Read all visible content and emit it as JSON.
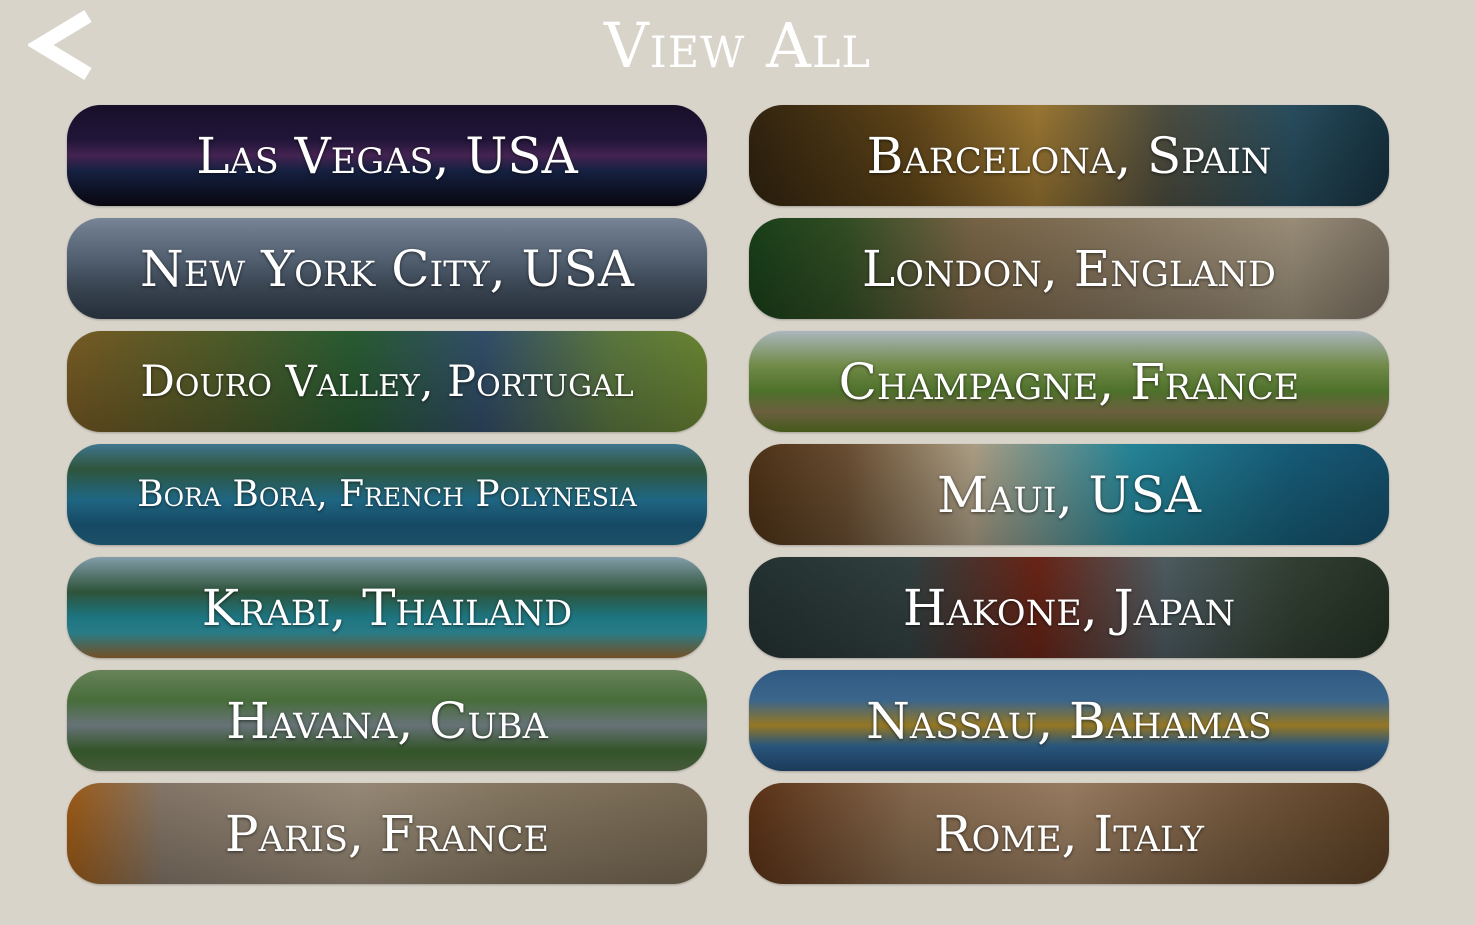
{
  "header": {
    "title": "View All",
    "back_icon": "chevron-left-icon"
  },
  "destinations": [
    {
      "label": "Las Vegas, USA",
      "id": "las-vegas"
    },
    {
      "label": "Barcelona, Spain",
      "id": "barcelona"
    },
    {
      "label": "New York City, USA",
      "id": "new-york-city"
    },
    {
      "label": "London, England",
      "id": "london"
    },
    {
      "label": "Douro Valley, Portugal",
      "id": "douro-valley"
    },
    {
      "label": "Champagne, France",
      "id": "champagne"
    },
    {
      "label": "Bora Bora, French Polynesia",
      "id": "bora-bora"
    },
    {
      "label": "Maui, USA",
      "id": "maui"
    },
    {
      "label": "Krabi, Thailand",
      "id": "krabi"
    },
    {
      "label": "Hakone, Japan",
      "id": "hakone"
    },
    {
      "label": "Havana, Cuba",
      "id": "havana"
    },
    {
      "label": "Nassau, Bahamas",
      "id": "nassau"
    },
    {
      "label": "Paris, France",
      "id": "paris"
    },
    {
      "label": "Rome, Italy",
      "id": "rome"
    }
  ],
  "colors": {
    "background": "#d9d4ca",
    "text": "#ffffff"
  }
}
